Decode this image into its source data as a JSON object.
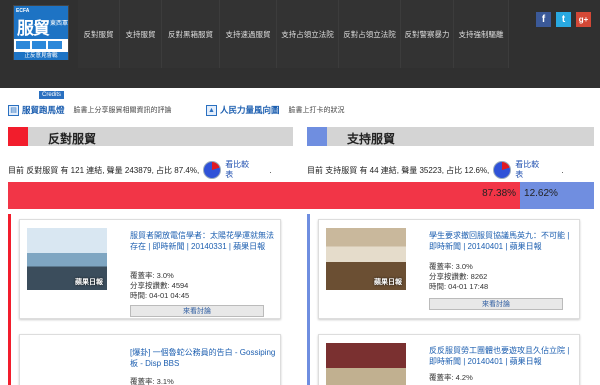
{
  "brand": {
    "ecfa": "ECFA",
    "big": "服貿",
    "sub": "東西軍",
    "bottom": "正反意見會戰"
  },
  "nav": [
    "反對服貿",
    "支持服貿",
    "反對黑箱服貿",
    "支持速過服貿",
    "支持占領立法院",
    "反對占領立法院",
    "反對警察暴力",
    "支持強制驅離"
  ],
  "social": {
    "fb": "f",
    "tw": "t",
    "gp": "g+"
  },
  "credits": "Credits",
  "infobar": {
    "tag1": {
      "label": "服貿跑馬燈",
      "desc": "臉書上分享服貿相關資訊的評論"
    },
    "tag2": {
      "label": "人民力量風向圖",
      "desc": "臉書上打卡的狀況"
    }
  },
  "oppose": {
    "title": "反對服貿",
    "stat": "目前 反對服貿 有 121 連結, 聲量 243879, 占比 87.4%,",
    "link1": "看比較",
    "link2": "表",
    "dot": "."
  },
  "support": {
    "title": "支持服貿",
    "stat": "目前 支持服貿 有 44 連結, 聲量 35223, 占比 12.6%,",
    "link1": "看比較",
    "link2": "表",
    "dot": "."
  },
  "ratio": {
    "oppose_pct": 87.38,
    "support_pct": 12.62,
    "oppose_label": "87.38%",
    "support_label": "12.62%"
  },
  "oppose_cards": [
    {
      "title": "服貿者開放電信學者：太陽花學運就無法存在 | 即時新聞 | 20140331 | 蘋果日報",
      "coverage": "覆蓋率: 3.0%",
      "shares": "分享按讚數: 4594",
      "time": "時間: 04-01 04:45",
      "button": "來看討論",
      "watermark": "蘋果日報"
    },
    {
      "title": "[爆卦] 一個魯蛇公務員的告白 - Gossiping板 - Disp BBS",
      "coverage": "覆蓋率: 3.1%"
    }
  ],
  "support_cards": [
    {
      "title": "學生要求撤回服貿協議馬英九：不可能 | 即時新聞 | 20140401 | 蘋果日報",
      "coverage": "覆蓋率: 3.0%",
      "shares": "分享按讚數: 8262",
      "time": "時間: 04-01 17:48",
      "button": "來看討論",
      "watermark": "蘋果日報"
    },
    {
      "title": "反反服貿勞工團體也要遊攻且久佔立院 | 即時新聞 | 20140401 | 蘋果日報",
      "coverage": "覆蓋率: 4.2%"
    }
  ]
}
